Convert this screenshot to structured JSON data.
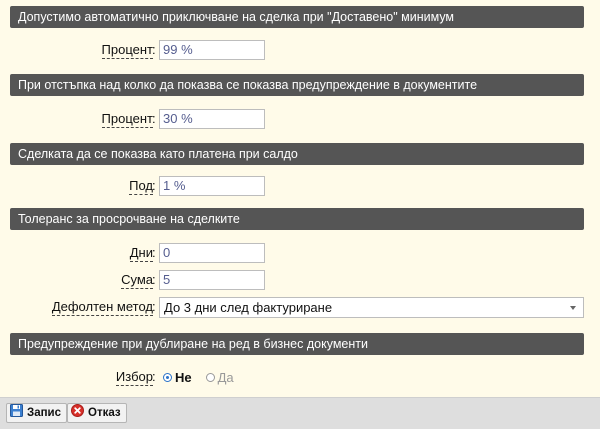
{
  "sections": {
    "auto_close": {
      "title": "Допустимо автоматично приключване на сделка при \"Доставено\" минимум"
    },
    "discount_warning": {
      "title": "При отстъпка над колко да показва се показва предупреждение в документите"
    },
    "paid_balance": {
      "title": "Сделката да се показва като платена при салдо"
    },
    "tolerance": {
      "title": "Толеранс за просрочване на сделките"
    },
    "duplicate_warning": {
      "title": "Предупреждение при дублиране на ред в бизнес документи"
    }
  },
  "fields": {
    "auto_close_percent": {
      "label": "Процент",
      "colon": ":",
      "value": "99 %"
    },
    "discount_percent": {
      "label": "Процент",
      "colon": ":",
      "value": "30 %"
    },
    "paid_under": {
      "label": "Под",
      "colon": ":",
      "value": "1 %"
    },
    "days": {
      "label": "Дни",
      "colon": ":",
      "value": "0"
    },
    "amount": {
      "label": "Сума",
      "colon": ":",
      "value": "5"
    },
    "default_method": {
      "label": "Дефолтен метод",
      "colon": ":",
      "value": "До 3 дни след фактуриране"
    },
    "choice": {
      "label": "Избор",
      "colon": ":",
      "options": [
        "Не",
        "Да"
      ],
      "selected": "Не"
    }
  },
  "toolbar": {
    "save_label": "Запис",
    "cancel_label": "Отказ"
  },
  "colors": {
    "page_bg": "#fffbe9",
    "header_bg": "#555555",
    "input_text": "#555d8f",
    "radio_accent": "#2d74c9",
    "cancel_red": "#d8302a",
    "save_blue": "#3b7fd0"
  },
  "icons": {
    "save": "floppy-disk-icon",
    "cancel": "cancel-circle-icon",
    "select_caret": "caret-down-icon"
  }
}
